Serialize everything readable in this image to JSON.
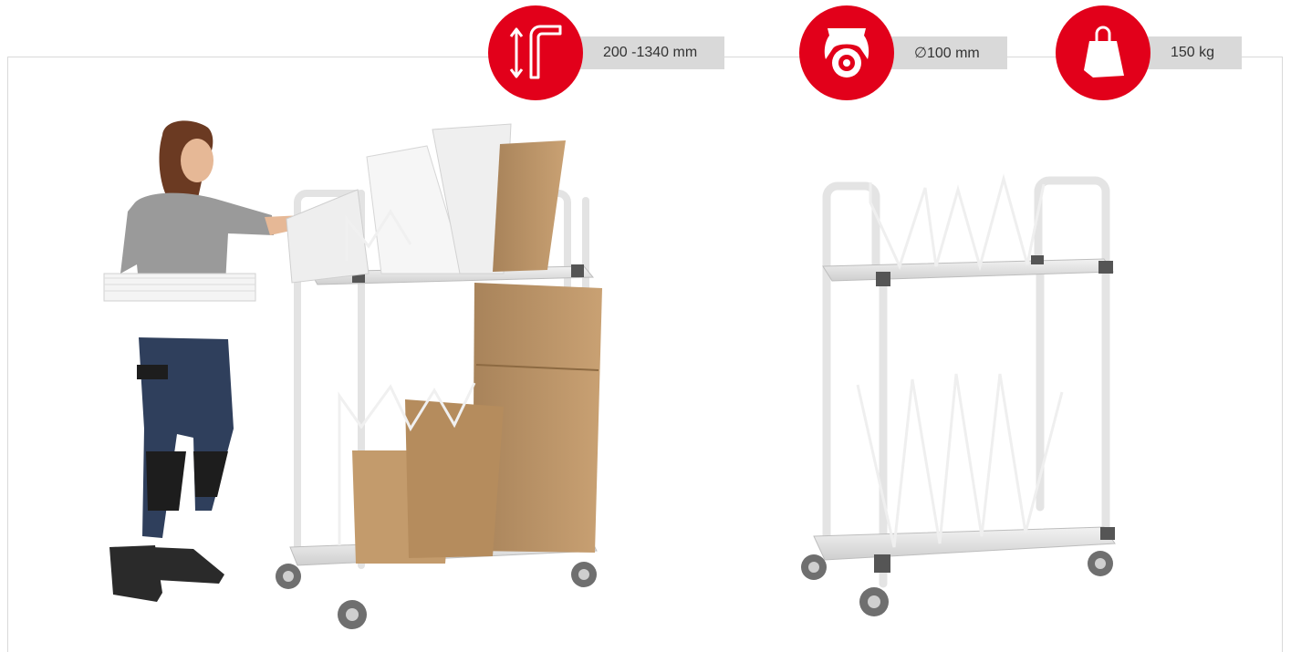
{
  "specs": [
    {
      "icon": "height-adjustment-icon",
      "label": "200 -1340 mm"
    },
    {
      "icon": "castor-wheel-icon",
      "label": "∅100 mm"
    },
    {
      "icon": "weight-icon",
      "label": "150 kg"
    }
  ],
  "colors": {
    "accent": "#e2001a",
    "pill": "#d9d9d9",
    "frame": "#d9d9d9"
  }
}
